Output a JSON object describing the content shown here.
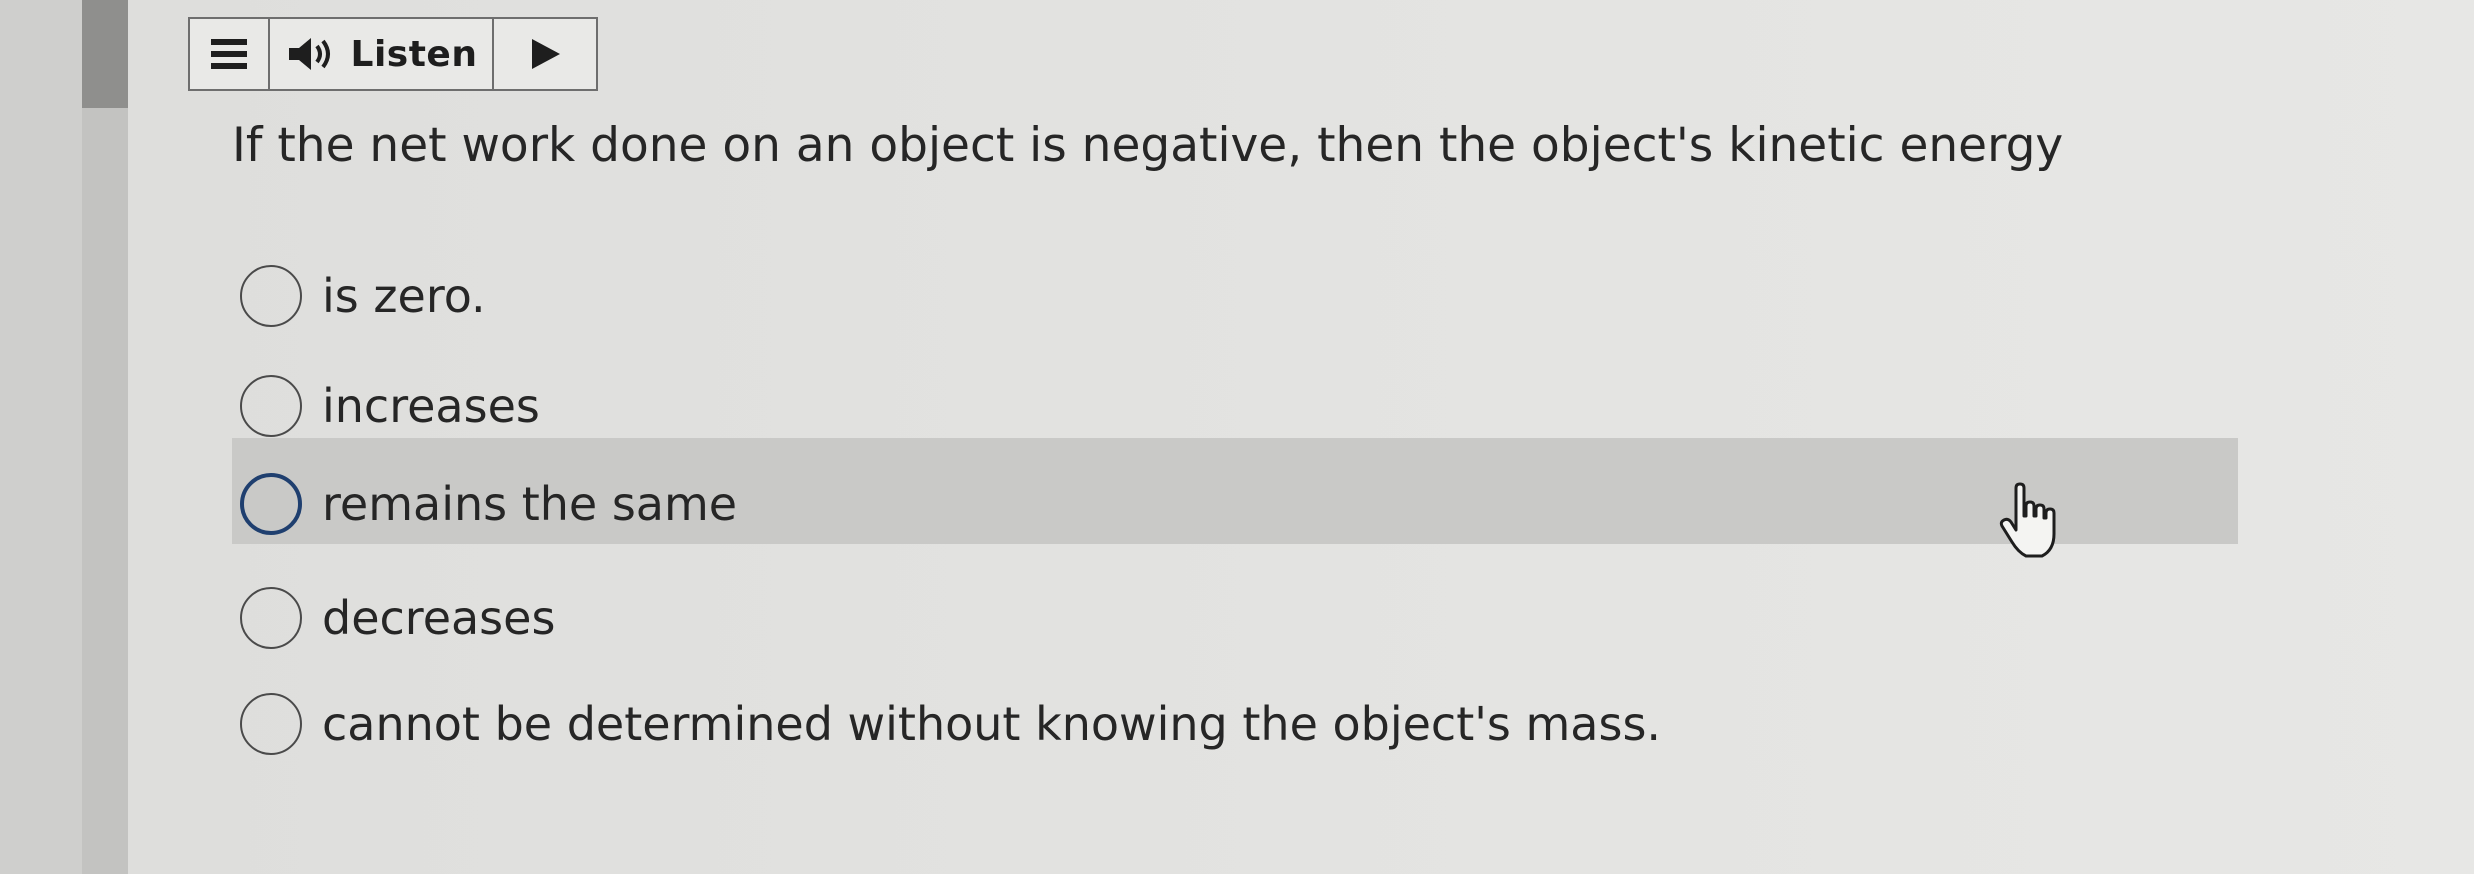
{
  "toolbar": {
    "menu_icon": "menu-bars-icon",
    "speaker_icon": "speaker-icon",
    "listen_label": "Listen",
    "play_icon": "play-triangle-icon"
  },
  "question": {
    "text": "If the net work done on an object is negative, then the object's kinetic energy"
  },
  "options": [
    {
      "label": "is zero.",
      "selected": false
    },
    {
      "label": "increases",
      "selected": false
    },
    {
      "label": "remains the same",
      "selected": false,
      "hovered": true
    },
    {
      "label": "decreases",
      "selected": false
    },
    {
      "label": "cannot be determined without knowing the object's mass.",
      "selected": false
    }
  ],
  "colors": {
    "hover_row": "#c9c9c7",
    "radio_hover_border": "#1f3f6f",
    "scroll_thumb": "#8f8f8d"
  }
}
